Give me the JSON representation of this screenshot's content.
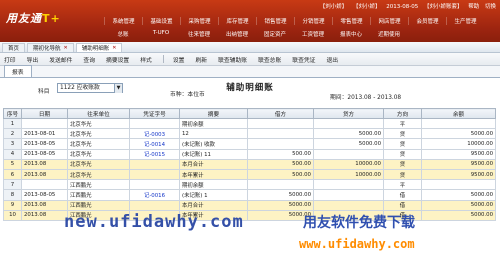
{
  "app": {
    "logo_text": "用友通",
    "logo_mark": "T+"
  },
  "status": {
    "user": "【刘小娇】",
    "user2": "【刘小娇】",
    "date": "2013-08-05",
    "company": "【刘小娇账套】",
    "help": "帮助",
    "exit": "切换"
  },
  "menu": [
    "系统管理",
    "基础设置",
    "采购管理",
    "库存管理",
    "销售管理",
    "分销管理",
    "零售管理",
    "网店管理",
    "会员管理",
    "生产管理"
  ],
  "menu2": [
    "总账",
    "T-UFO",
    "往来管理",
    "出纳管理",
    "固定资产",
    "工资管理",
    "报表中心",
    "近期使用"
  ],
  "tabs": [
    "首页",
    "期初化导航",
    "辅助明细账"
  ],
  "toolbar": [
    "打印",
    "导出",
    "发送邮件",
    "查询",
    "摘要设置",
    "样式",
    "设置",
    "刷新",
    "联查辅助账",
    "联查总账",
    "联查凭证",
    "退出"
  ],
  "subtab": "报表",
  "title": "辅助明细账",
  "subject_label": "科目",
  "subject_value": "1122 应收账款",
  "currency": "币种：本位币",
  "period": "期间：2013.08 - 2013.08",
  "columns": [
    "序号",
    "日期",
    "往来单位",
    "凭证字号",
    "摘要",
    "借方",
    "贷方",
    "方向",
    "余额"
  ],
  "rows": [
    {
      "n": "1",
      "date": "",
      "unit": "北京华光",
      "voucher": "",
      "summary": "期初余额",
      "debit": "",
      "credit": "",
      "dir": "平",
      "bal": "",
      "sum": false
    },
    {
      "n": "2",
      "date": "2013-08-01",
      "unit": "北京华光",
      "voucher": "记-0003",
      "summary": "12",
      "debit": "",
      "credit": "5000.00",
      "dir": "贷",
      "bal": "5000.00",
      "sum": false
    },
    {
      "n": "3",
      "date": "2013-08-05",
      "unit": "北京华光",
      "voucher": "记-0014",
      "summary": "(未记账) 收款",
      "debit": "",
      "credit": "5000.00",
      "dir": "贷",
      "bal": "10000.00",
      "sum": false
    },
    {
      "n": "4",
      "date": "2013-08-05",
      "unit": "北京华光",
      "voucher": "记-0015",
      "summary": "(未记账) 11",
      "debit": "500.00",
      "credit": "",
      "dir": "贷",
      "bal": "9500.00",
      "sum": false
    },
    {
      "n": "5",
      "date": "2013.08",
      "unit": "北京华光",
      "voucher": "",
      "summary": "本月合计",
      "debit": "500.00",
      "credit": "10000.00",
      "dir": "贷",
      "bal": "9500.00",
      "sum": true
    },
    {
      "n": "6",
      "date": "2013.08",
      "unit": "北京华光",
      "voucher": "",
      "summary": "本年累计",
      "debit": "500.00",
      "credit": "10000.00",
      "dir": "贷",
      "bal": "9500.00",
      "sum": true
    },
    {
      "n": "7",
      "date": "",
      "unit": "江西鹏光",
      "voucher": "",
      "summary": "期初余额",
      "debit": "",
      "credit": "",
      "dir": "平",
      "bal": "",
      "sum": false
    },
    {
      "n": "8",
      "date": "2013-08-05",
      "unit": "江西鹏光",
      "voucher": "记-0016",
      "summary": "(未记账) 1",
      "debit": "5000.00",
      "credit": "",
      "dir": "借",
      "bal": "5000.00",
      "sum": false
    },
    {
      "n": "9",
      "date": "2013.08",
      "unit": "江西鹏光",
      "voucher": "",
      "summary": "本月合计",
      "debit": "5000.00",
      "credit": "",
      "dir": "借",
      "bal": "5000.00",
      "sum": true
    },
    {
      "n": "10",
      "date": "2013.08",
      "unit": "江西鹏光",
      "voucher": "",
      "summary": "本年累计",
      "debit": "5000.00",
      "credit": "",
      "dir": "借",
      "bal": "5000.00",
      "sum": true
    }
  ],
  "watermark": {
    "url": "new.ufidawhy.com",
    "cn": "用友软件免费下载",
    "url2": "www.ufidawhy.com"
  }
}
